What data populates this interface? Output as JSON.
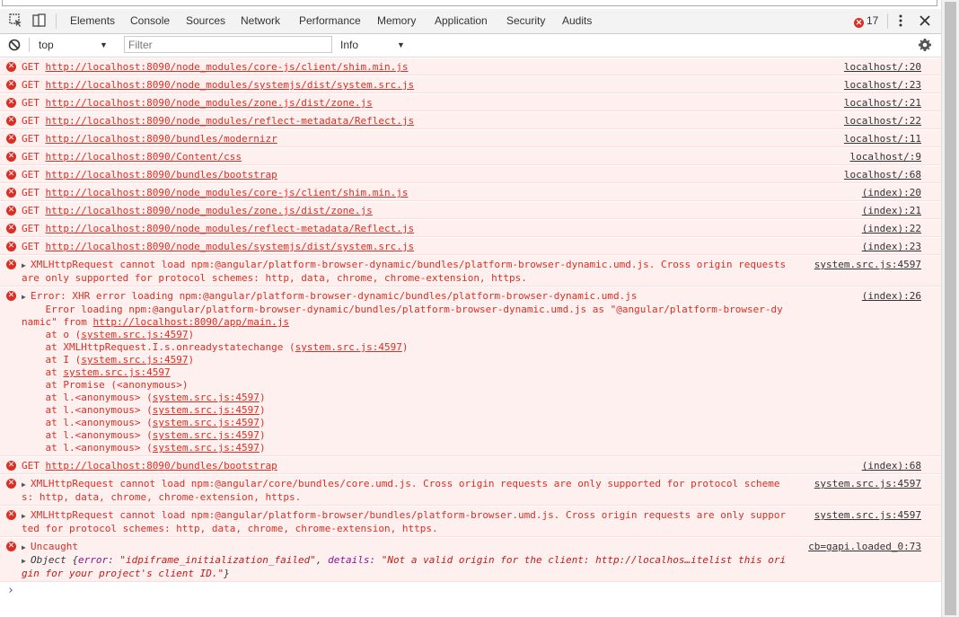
{
  "tabs": [
    "Elements",
    "Console",
    "Sources",
    "Network",
    "Performance",
    "Memory",
    "Application",
    "Security",
    "Audits"
  ],
  "error_count": "17",
  "toolbar": {
    "context": "top",
    "filter_placeholder": "Filter",
    "levels": "Info"
  },
  "messages": [
    {
      "kind": "get",
      "url": "http://localhost:8090/node_modules/core-js/client/shim.min.js",
      "src": "localhost/:20"
    },
    {
      "kind": "get",
      "url": "http://localhost:8090/node_modules/systemjs/dist/system.src.js",
      "src": "localhost/:23"
    },
    {
      "kind": "get",
      "url": "http://localhost:8090/node_modules/zone.js/dist/zone.js",
      "src": "localhost/:21"
    },
    {
      "kind": "get",
      "url": "http://localhost:8090/node_modules/reflect-metadata/Reflect.js",
      "src": "localhost/:22"
    },
    {
      "kind": "get",
      "url": "http://localhost:8090/bundles/modernizr",
      "src": "localhost/:11"
    },
    {
      "kind": "get",
      "url": "http://localhost:8090/Content/css",
      "src": "localhost/:9"
    },
    {
      "kind": "get",
      "url": "http://localhost:8090/bundles/bootstrap",
      "src": "localhost/:68"
    },
    {
      "kind": "get",
      "url": "http://localhost:8090/node_modules/core-js/client/shim.min.js",
      "src": "(index):20"
    },
    {
      "kind": "get",
      "url": "http://localhost:8090/node_modules/zone.js/dist/zone.js",
      "src": "(index):21"
    },
    {
      "kind": "get",
      "url": "http://localhost:8090/node_modules/reflect-metadata/Reflect.js",
      "src": "(index):22"
    },
    {
      "kind": "get",
      "url": "http://localhost:8090/node_modules/systemjs/dist/system.src.js",
      "src": "(index):23"
    },
    {
      "kind": "text",
      "text": "XMLHttpRequest cannot load npm:@angular/platform-browser-dynamic/bundles/platform-browser-dynamic.umd.js. Cross origin requests are only supported for protocol schemes: http, data, chrome, chrome-extension, https.",
      "src": "system.src.js:4597"
    },
    {
      "kind": "stack",
      "text": "Error: XHR error loading npm:@angular/platform-browser-dynamic/bundles/platform-browser-dynamic.umd.js",
      "detail": "Error loading npm:@angular/platform-browser-dynamic/bundles/platform-browser-dynamic.umd.js as \"@angular/platform-browser-dynamic\" from ",
      "detail_link": "http://localhost:8090/app/main.js",
      "frames": [
        {
          "pre": "at o (",
          "link": "system.src.js:4597",
          "post": ")"
        },
        {
          "pre": "at XMLHttpRequest.I.s.onreadystatechange (",
          "link": "system.src.js:4597",
          "post": ")"
        },
        {
          "pre": "at I (",
          "link": "system.src.js:4597",
          "post": ")"
        },
        {
          "pre": "at ",
          "link": "system.src.js:4597",
          "post": ""
        },
        {
          "pre": "at Promise (<anonymous>)",
          "link": "",
          "post": ""
        },
        {
          "pre": "at l.<anonymous> (",
          "link": "system.src.js:4597",
          "post": ")"
        },
        {
          "pre": "at l.<anonymous> (",
          "link": "system.src.js:4597",
          "post": ")"
        },
        {
          "pre": "at l.<anonymous> (",
          "link": "system.src.js:4597",
          "post": ")"
        },
        {
          "pre": "at l.<anonymous> (",
          "link": "system.src.js:4597",
          "post": ")"
        },
        {
          "pre": "at l.<anonymous> (",
          "link": "system.src.js:4597",
          "post": ")"
        }
      ],
      "src": "(index):26"
    },
    {
      "kind": "get",
      "url": "http://localhost:8090/bundles/bootstrap",
      "src": "(index):68"
    },
    {
      "kind": "text",
      "text": "XMLHttpRequest cannot load npm:@angular/core/bundles/core.umd.js. Cross origin requests are only supported for protocol schemes: http, data, chrome, chrome-extension, https.",
      "src": "system.src.js:4597"
    },
    {
      "kind": "text",
      "text": "XMLHttpRequest cannot load npm:@angular/platform-browser/bundles/platform-browser.umd.js. Cross origin requests are only supported for protocol schemes: http, data, chrome, chrome-extension, https.",
      "src": "system.src.js:4597"
    },
    {
      "kind": "uncaught",
      "text": "Uncaught",
      "src": "cb=gapi.loaded_0:73",
      "obj_prefix": "Object {",
      "k1": "error:",
      "v1": "\"idpiframe_initialization_failed\"",
      "k2": "details:",
      "v2": "\"Not a valid origin for the client: http://localhos…itelist this origin for your project's client ID.\"",
      "obj_suffix": "}"
    }
  ],
  "prompt": "›"
}
